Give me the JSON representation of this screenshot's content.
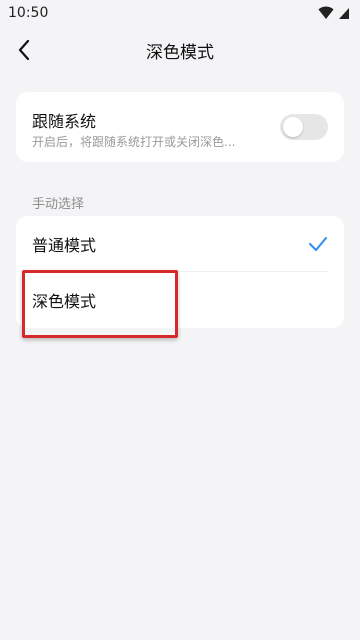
{
  "status_bar": {
    "time": "10:50",
    "icons": [
      "wifi-icon",
      "signal-icon"
    ]
  },
  "header": {
    "title": "深色模式",
    "back_icon": "chevron-left-icon"
  },
  "follow_system": {
    "title": "跟随系统",
    "subtitle": "开启后，将跟随系统打开或关闭深色...",
    "enabled": false
  },
  "manual_section": {
    "label": "手动选择",
    "options": [
      {
        "label": "普通模式",
        "selected": true
      },
      {
        "label": "深色模式",
        "selected": false
      }
    ]
  },
  "colors": {
    "accent": "#2f8cf0",
    "highlight": "#d42a2a",
    "background": "#f4f4f6"
  }
}
